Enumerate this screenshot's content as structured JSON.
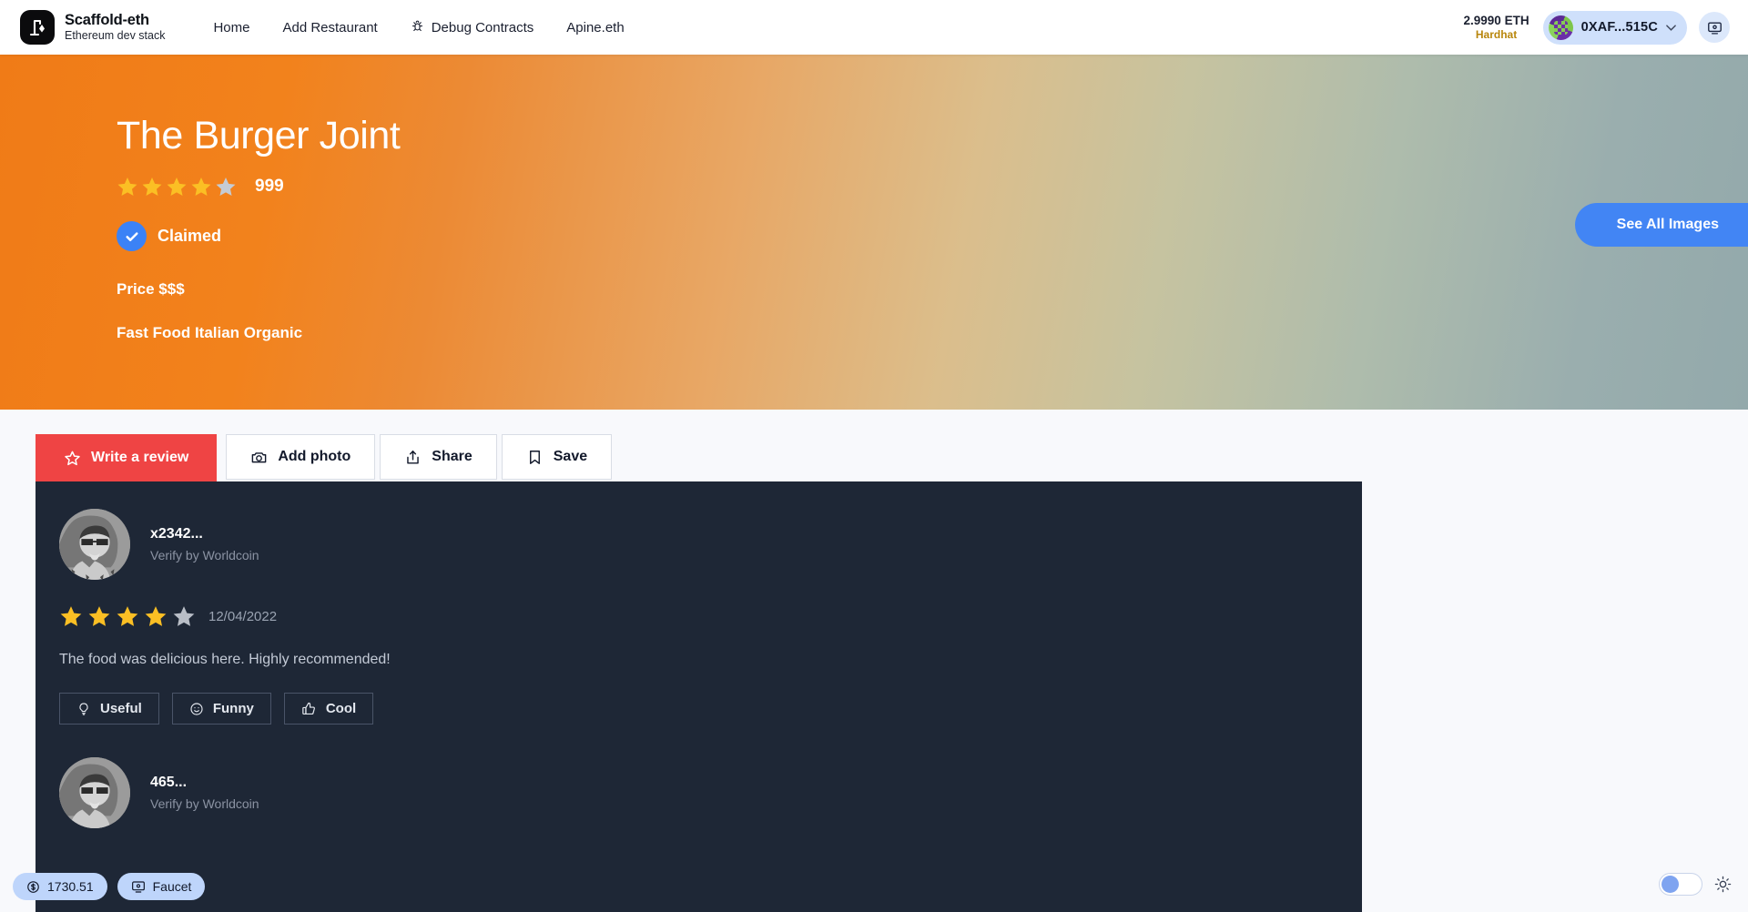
{
  "header": {
    "logo_icon": "scaffold-eth-logo-icon",
    "brand_title": "Scaffold-eth",
    "brand_subtitle": "Ethereum dev stack",
    "nav": [
      {
        "label": "Home",
        "icon": null
      },
      {
        "label": "Add Restaurant",
        "icon": null
      },
      {
        "label": "Debug Contracts",
        "icon": "bug-icon"
      },
      {
        "label": "Apine.eth",
        "icon": null
      }
    ],
    "balance_amount": "2.9990",
    "balance_unit": "ETH",
    "network": "Hardhat",
    "wallet_address": "0XAF...515C",
    "wallet_chevron_icon": "chevron-down-icon",
    "screen_icon": "display-icon"
  },
  "hero": {
    "title": "The Burger Joint",
    "rating": 4,
    "max_rating": 5,
    "review_count": "999",
    "claimed_label": "Claimed",
    "claimed_icon": "check-icon",
    "price_label": "Price $$$",
    "tags_label": "Fast Food Italian Organic",
    "see_all_images_label": "See All Images",
    "gradient_start": "#f07b17",
    "gradient_end": "#93a9ab",
    "accent_blue": "#4285f4",
    "star_filled_color": "#fbbf24",
    "star_empty_color": "#c5cbd3"
  },
  "actions": [
    {
      "label": "Write a review",
      "icon": "star-outline-icon",
      "primary": true
    },
    {
      "label": "Add photo",
      "icon": "camera-icon",
      "primary": false
    },
    {
      "label": "Share",
      "icon": "share-icon",
      "primary": false
    },
    {
      "label": "Save",
      "icon": "bookmark-icon",
      "primary": false
    }
  ],
  "reviews": {
    "panel_color": "#1e2736",
    "items": [
      {
        "name": "x2342...",
        "verify": "Verify by Worldcoin",
        "rating": 4,
        "date": "12/04/2022",
        "text": "The food was delicious here. Highly recommended!",
        "reactions": [
          {
            "label": "Useful",
            "icon": "lightbulb-icon"
          },
          {
            "label": "Funny",
            "icon": "smiley-icon"
          },
          {
            "label": "Cool",
            "icon": "thumbs-up-icon"
          }
        ]
      },
      {
        "name": "465...",
        "verify": "Verify by Worldcoin",
        "rating": 0,
        "date": "",
        "text": "",
        "reactions": []
      }
    ]
  },
  "footer": {
    "price_value": "1730.51",
    "price_icon": "dollar-icon",
    "faucet_label": "Faucet",
    "faucet_icon": "display-icon",
    "theme_toggle_on": false,
    "theme_icon": "sun-icon"
  }
}
